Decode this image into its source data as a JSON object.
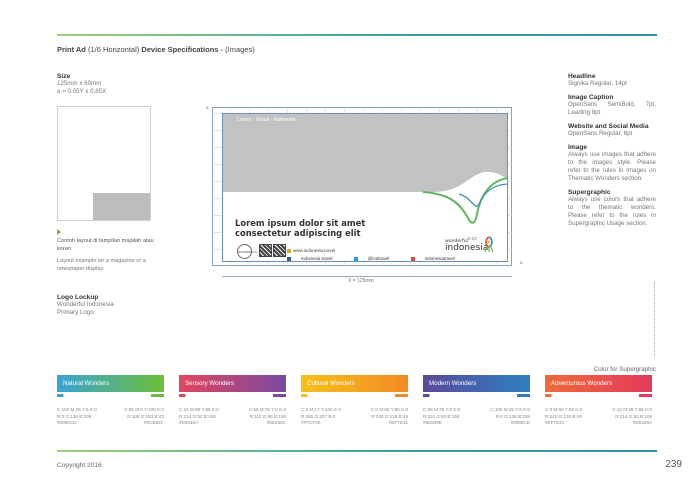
{
  "header": {
    "title_bold_1": "Print Ad",
    "title_normal": " (1/6 Horizontal) ",
    "title_bold_2": "Device Specifications - ",
    "title_paren": "(Images)"
  },
  "size": {
    "label": "Size",
    "line1": "125mm x 60mm",
    "line2": "a = 0.05Y x 0.85X"
  },
  "layout_caption": {
    "id": "Contoh layout di tampilan majalah atau koran",
    "en": "Layout example on a magazine or a newspaper display."
  },
  "logo_lockup": {
    "label": "Logo Lockup",
    "line1": "Wonderful Indonesia",
    "line2": "Primary Logo"
  },
  "ad": {
    "image_label": "Lorem - Visual - Indonesia",
    "headline_1": "Lorem ipsum dolor sit amet",
    "headline_2": "consectetur adipiscing elit",
    "badge": "WONDERFUL",
    "website": "www.indonesia.travel",
    "social": [
      "indonesia.travel",
      "@indtravel",
      "indonesiatravel"
    ],
    "logo_small": "wonderful",
    "logo_big": "indonesia",
    "dim_a_left": "a",
    "dim_a_right": "0.2X",
    "dim_width": "X = 125mm",
    "dim_y": "Y"
  },
  "specs": [
    {
      "label": "Headline",
      "value": "Signika Regular, 14pt"
    },
    {
      "label": "Image Caption",
      "value": "OpenSans SemiBold, 7pt, Leading 8pt"
    },
    {
      "label": "Website and Social Media",
      "value": "OpenSans Regular, 6pt"
    },
    {
      "label": "Image",
      "value": "Always use images that adhere to the images style. Please refer to the rules in Images on Thematic Wonders section."
    },
    {
      "label": "Supergraphic",
      "value": "Always use colors that adhere to the thematic wonders. Please refer to the rules in Supergraphic Usage section."
    }
  ],
  "supergraphic": {
    "title": "Color for Supergraphic",
    "swatches": [
      {
        "label": "Natural Wonders",
        "c1": "#3aa3d2",
        "c2": "#6cbf3a",
        "left": [
          "C:100 M:25 Y:6 K:0",
          "R:0 G:136 B:205",
          "#0088CD"
        ],
        "right": [
          "C:65 M:0 Y:100 K:0",
          "R:108 G:183 B:43",
          "#6CB82C"
        ]
      },
      {
        "label": "Sensory Wonders",
        "c1": "#e0465e",
        "c2": "#7b4aa0",
        "left": [
          "C:12 M:89 Y:56 K:0",
          "R:214 G:52 B:106",
          "#D5346A"
        ],
        "right": [
          "C:68 M:75 Y:0 K:0",
          "R:110 G:86 B:156",
          "#6E569C"
        ]
      },
      {
        "label": "Cultural Wonders",
        "c1": "#f6c21a",
        "c2": "#f08a24",
        "left": [
          "C:0 M:17 Y:100 K:0",
          "R:255 G:207 B:0",
          "#FFCF00"
        ],
        "right": [
          "C:0 M:60 Y:85 K:0",
          "R:240 G:126 B:49",
          "#EF7E31"
        ]
      },
      {
        "label": "Modern Wonders",
        "c1": "#5a4a9a",
        "c2": "#2e7fc0",
        "left": [
          "C:69 M:75 Y:0 K:0",
          "R:110 G:80 B:158",
          "#6E509E"
        ],
        "right": [
          "C:100 M:25 Y:6 K:0",
          "R:0 G:136 B:205",
          "#0088CD"
        ]
      },
      {
        "label": "Adventurous Wonders",
        "c1": "#ee6b3a",
        "c2": "#e23b5b",
        "left": [
          "C:0 M:60 Y:85 K:0",
          "R:240 G:126 B:49",
          "#EF7E31"
        ],
        "right": [
          "C:12 M:89 Y:56 K:0",
          "R:214 G:52 B:106",
          "#D5346A"
        ]
      }
    ]
  },
  "footer": {
    "copyright": "Copyright 2016",
    "page": "239"
  }
}
